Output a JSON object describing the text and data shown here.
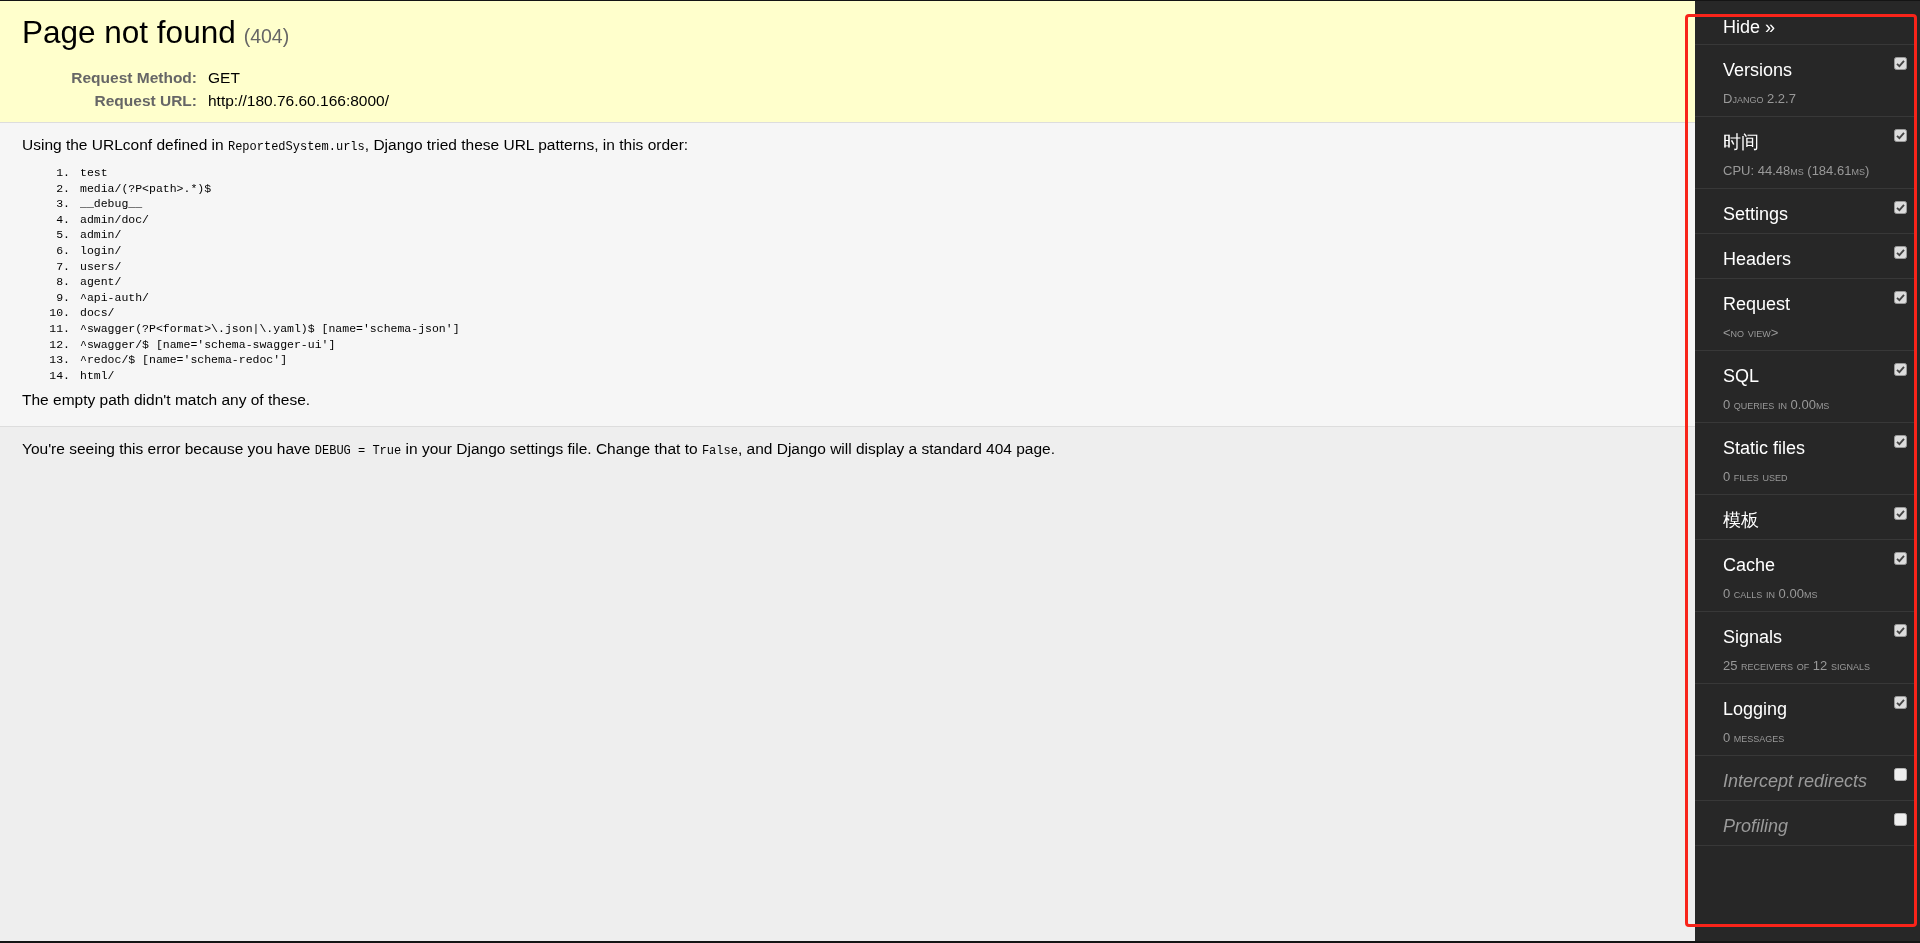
{
  "summary": {
    "title": "Page not found",
    "code": "(404)",
    "request": [
      {
        "label": "Request Method:",
        "value": "GET"
      },
      {
        "label": "Request URL:",
        "value": "http://180.76.60.166:8000/"
      }
    ]
  },
  "info": {
    "intro": [
      {
        "kind": "text",
        "text": "Using the URLconf defined in "
      },
      {
        "kind": "code",
        "text": "ReportedSystem.urls"
      },
      {
        "kind": "text",
        "text": ", Django tried these URL patterns, in this order:"
      }
    ],
    "patterns": [
      {
        "number": "1.",
        "pattern": "test"
      },
      {
        "number": "2.",
        "pattern": "media/(?P<path>.*)$"
      },
      {
        "number": "3.",
        "pattern": "__debug__"
      },
      {
        "number": "4.",
        "pattern": "admin/doc/"
      },
      {
        "number": "5.",
        "pattern": "admin/"
      },
      {
        "number": "6.",
        "pattern": "login/"
      },
      {
        "number": "7.",
        "pattern": "users/"
      },
      {
        "number": "8.",
        "pattern": "agent/"
      },
      {
        "number": "9.",
        "pattern": "^api-auth/"
      },
      {
        "number": "10.",
        "pattern": "docs/"
      },
      {
        "number": "11.",
        "pattern": "^swagger(?P<format>\\.json|\\.yaml)$ [name='schema-json']"
      },
      {
        "number": "12.",
        "pattern": "^swagger/$ [name='schema-swagger-ui']"
      },
      {
        "number": "13.",
        "pattern": "^redoc/$ [name='schema-redoc']"
      },
      {
        "number": "14.",
        "pattern": "html/"
      }
    ],
    "conclusion": "The empty path didn't match any of these."
  },
  "explanation": [
    {
      "kind": "text",
      "text": "You're seeing this error because you have "
    },
    {
      "kind": "code",
      "text": "DEBUG = True"
    },
    {
      "kind": "text",
      "text": " in your Django settings file. Change that to "
    },
    {
      "kind": "code",
      "text": "False"
    },
    {
      "kind": "text",
      "text": ", and Django will display a standard 404 page."
    }
  ],
  "toolbar": {
    "hide_label": "Hide »",
    "panels": [
      {
        "title": "Versions",
        "subtitle": "Django 2.2.7",
        "checked": true
      },
      {
        "title": "时间",
        "subtitle": "CPU: 44.48ms (184.61ms)",
        "checked": true
      },
      {
        "title": "Settings",
        "checked": true
      },
      {
        "title": "Headers",
        "checked": true
      },
      {
        "title": "Request",
        "subtitle": "<no view>",
        "checked": true
      },
      {
        "title": "SQL",
        "subtitle": "0 queries in 0.00ms",
        "checked": true
      },
      {
        "title": "Static files",
        "subtitle": "0 files used",
        "checked": true
      },
      {
        "title": "模板",
        "checked": true
      },
      {
        "title": "Cache",
        "subtitle": "0 calls in 0.00ms",
        "checked": true
      },
      {
        "title": "Signals",
        "subtitle": "25 receivers of 12 signals",
        "checked": true
      },
      {
        "title": "Logging",
        "subtitle": "0 messages",
        "checked": true
      },
      {
        "title": "Intercept redirects",
        "checked": false
      },
      {
        "title": "Profiling",
        "checked": false
      }
    ]
  }
}
